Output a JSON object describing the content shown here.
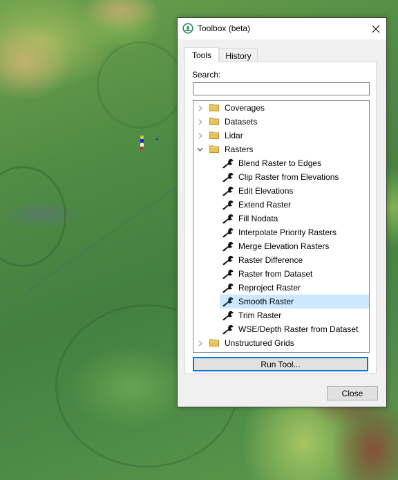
{
  "background": {
    "type": "terrain-elevation-map",
    "colors": {
      "lowland": "#4a8843",
      "midland": "#7fb055",
      "upland": "#c9b56c",
      "highland": "#8a5038",
      "water": "#5a7a6e"
    }
  },
  "dialog": {
    "title": "Toolbox (beta)",
    "app_icon": "xms-tree-logo-icon",
    "close_icon": "close-icon",
    "tabs": [
      {
        "label": "Tools",
        "active": true
      },
      {
        "label": "History",
        "active": false
      }
    ],
    "search": {
      "label": "Search:",
      "value": "",
      "placeholder": ""
    },
    "tree": {
      "folders": [
        {
          "label": "Coverages",
          "expanded": false
        },
        {
          "label": "Datasets",
          "expanded": false
        },
        {
          "label": "Lidar",
          "expanded": false
        },
        {
          "label": "Rasters",
          "expanded": true,
          "tools": [
            {
              "label": "Blend Raster to Edges"
            },
            {
              "label": "Clip Raster from Elevations"
            },
            {
              "label": "Edit Elevations"
            },
            {
              "label": "Extend Raster"
            },
            {
              "label": "Fill Nodata"
            },
            {
              "label": "Interpolate Priority Rasters"
            },
            {
              "label": "Merge Elevation Rasters"
            },
            {
              "label": "Raster Difference"
            },
            {
              "label": "Raster from Dataset"
            },
            {
              "label": "Reproject Raster"
            },
            {
              "label": "Smooth Raster",
              "selected": true
            },
            {
              "label": "Trim Raster"
            },
            {
              "label": "WSE/Depth Raster from Dataset"
            }
          ]
        },
        {
          "label": "Unstructured Grids",
          "expanded": false
        }
      ]
    },
    "run_button_label": "Run Tool...",
    "close_button_label": "Close",
    "colors": {
      "selection": "#cce8ff",
      "focus_border": "#0078d7",
      "folder": "#e8c25a",
      "logo": "#2e8b57"
    }
  }
}
